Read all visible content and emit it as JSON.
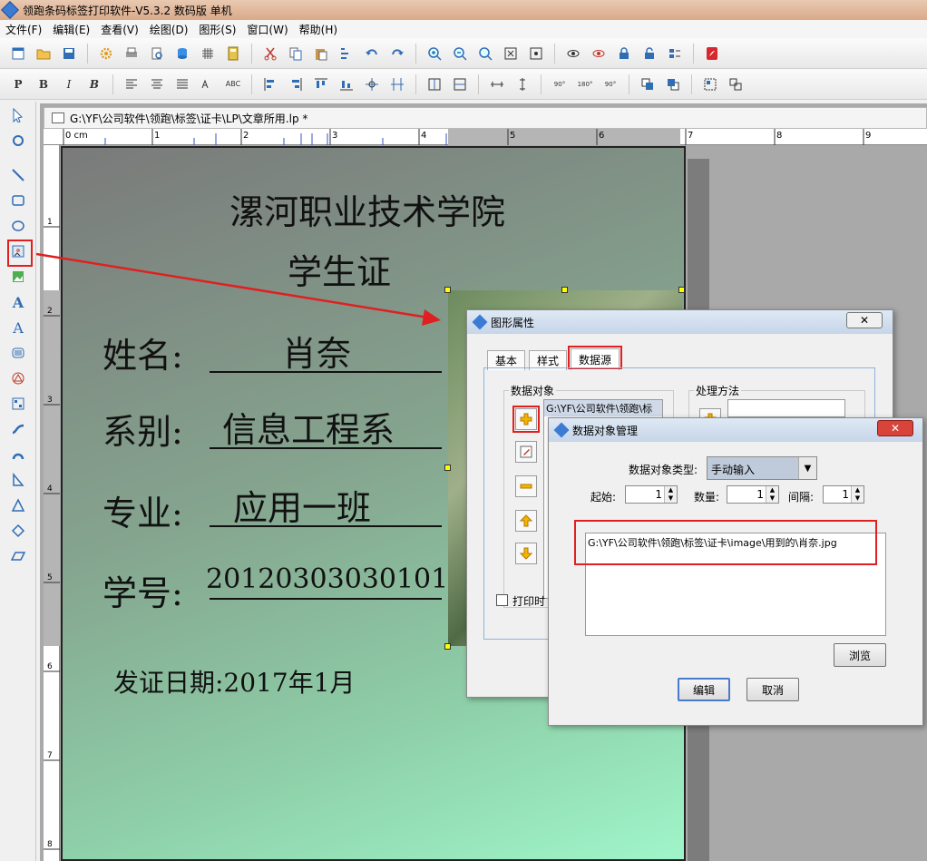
{
  "window": {
    "title": "领跑条码标签打印软件-V5.3.2 数码版 单机"
  },
  "menu": [
    "文件(F)",
    "编辑(E)",
    "查看(V)",
    "绘图(D)",
    "图形(S)",
    "窗口(W)",
    "帮助(H)"
  ],
  "format_toolbar": {
    "bold_p": "P",
    "bold_b": "B",
    "italic": "I",
    "bold_italic": "B",
    "abc": "ABC",
    "rot90": "90°",
    "rot180": "180°",
    "rot270": "90°"
  },
  "document": {
    "tab_title": "G:\\YF\\公司软件\\领跑\\标签\\证卡\\LP\\文章所用.lp *",
    "ruler_unit": "0 cm",
    "ruler_marks": [
      "1",
      "2",
      "3",
      "4",
      "5",
      "6",
      "7",
      "8",
      "9"
    ],
    "vruler_marks": [
      "1",
      "2",
      "3",
      "4",
      "5",
      "6",
      "7",
      "8"
    ]
  },
  "card": {
    "school": "漯河职业技术学院",
    "heading": "学生证",
    "name_label": "姓名:",
    "name_value": "肖奈",
    "dept_label": "系别:",
    "dept_value": "信息工程系",
    "major_label": "专业:",
    "major_value": "应用一班",
    "id_label": "学号:",
    "id_value": "201203030301016",
    "issue_date": "发证日期:2017年1月"
  },
  "props_dialog": {
    "title": "图形属性",
    "close": "✕",
    "tabs": [
      "基本",
      "样式",
      "数据源"
    ],
    "data_objects_label": "数据对象",
    "data_object_item": "G:\\YF\\公司软件\\领跑\\标",
    "processing_label": "处理方法",
    "print_checkbox": "打印时"
  },
  "dom_dialog": {
    "title": "数据对象管理",
    "close": "✕",
    "type_label": "数据对象类型:",
    "type_value": "手动输入",
    "start_label": "起始:",
    "start_value": "1",
    "count_label": "数量:",
    "count_value": "1",
    "interval_label": "间隔:",
    "interval_value": "1",
    "text_value": "G:\\YF\\公司软件\\领跑\\标签\\证卡\\image\\用到的\\肖奈.jpg",
    "browse": "浏览",
    "edit": "编辑",
    "cancel": "取消"
  },
  "colors": {
    "highlight_red": "#e02020",
    "card_gradient_start": "#7a7a7a",
    "card_gradient_end": "#9ff5c9",
    "handle": "#ffff00"
  }
}
